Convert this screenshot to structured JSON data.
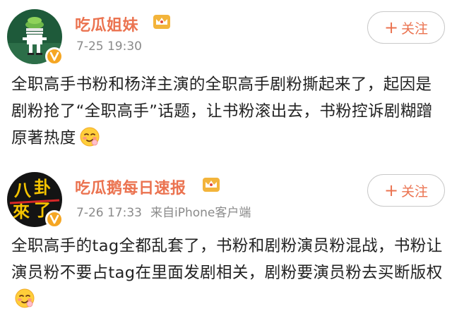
{
  "posts": [
    {
      "username": "吃瓜姐妹",
      "time": "7-25 19:30",
      "source": "",
      "follow_label": "关注",
      "content": "全职高手书粉和杨洋主演的全职高手剧粉撕起来了，起因是剧粉抢了“全职高手”话题，让书粉滚出去，书粉控诉剧糊蹭原著热度",
      "emoji": "smirk-emoji"
    },
    {
      "username": "吃瓜鹅每日速报",
      "time": "7-26 17:33",
      "source": "来自iPhone客户端",
      "follow_label": "关注",
      "content": "全职高手的tag全都乱套了，书粉和剧粉演员粉混战，书粉让演员粉不要占tag在里面发剧相关，剧粉要演员粉去买断版权",
      "emoji": "smirk-emoji",
      "avatar_text": [
        "八",
        "卦",
        "來",
        "了"
      ]
    }
  ],
  "colors": {
    "username": "#eb7350",
    "meta": "#8a8a8a",
    "badge": "#f5a623"
  }
}
